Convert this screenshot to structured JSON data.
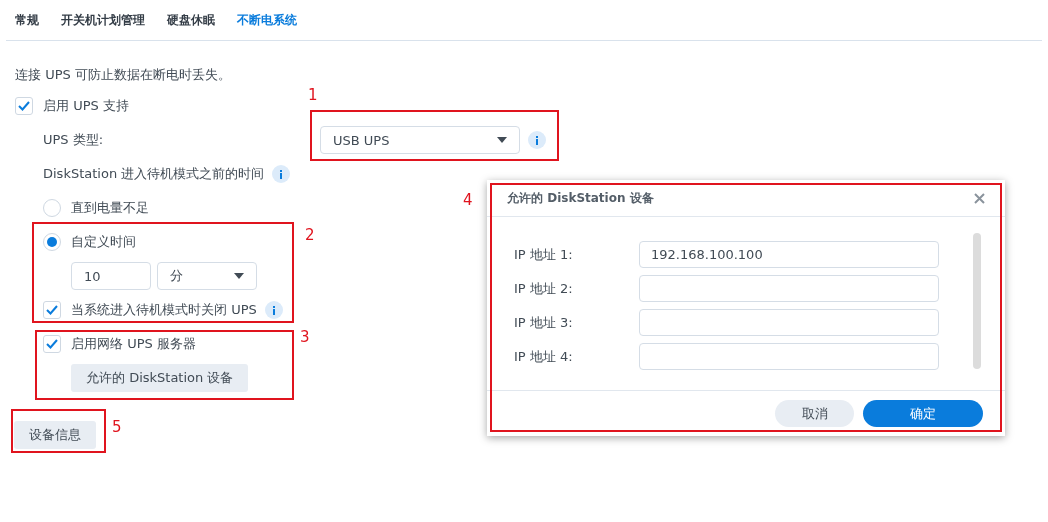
{
  "tabs": [
    {
      "label": "常规",
      "selected": false
    },
    {
      "label": "开关机计划管理",
      "selected": false
    },
    {
      "label": "硬盘休眠",
      "selected": false
    },
    {
      "label": "不断电系统",
      "selected": true
    }
  ],
  "intro": "连接 UPS 可防止数据在断电时丢失。",
  "enable_ups": {
    "label": "启用 UPS 支持",
    "checked": true
  },
  "ups_type": {
    "label": "UPS 类型:",
    "value": "USB UPS"
  },
  "standby_time_label": "DiskStation 进入待机模式之前的时间",
  "standby_options": [
    {
      "label": "直到电量不足",
      "selected": false
    },
    {
      "label": "自定义时间",
      "selected": true
    }
  ],
  "custom_time": {
    "value": "10",
    "unit": "分"
  },
  "shutdown_ups": {
    "label": "当系统进入待机模式时关闭 UPS",
    "checked": true
  },
  "network_ups": {
    "label": "启用网络 UPS 服务器",
    "checked": true
  },
  "allowed_button": "允许的 DiskStation 设备",
  "device_info_button": "设备信息",
  "dialog": {
    "title": "允许的 DiskStation 设备",
    "rows": [
      {
        "label": "IP 地址 1:",
        "value": "192.168.100.100"
      },
      {
        "label": "IP 地址 2:",
        "value": ""
      },
      {
        "label": "IP 地址 3:",
        "value": ""
      },
      {
        "label": "IP 地址 4:",
        "value": ""
      }
    ],
    "cancel": "取消",
    "ok": "确定"
  },
  "annotations": [
    "1",
    "2",
    "3",
    "4",
    "5"
  ]
}
